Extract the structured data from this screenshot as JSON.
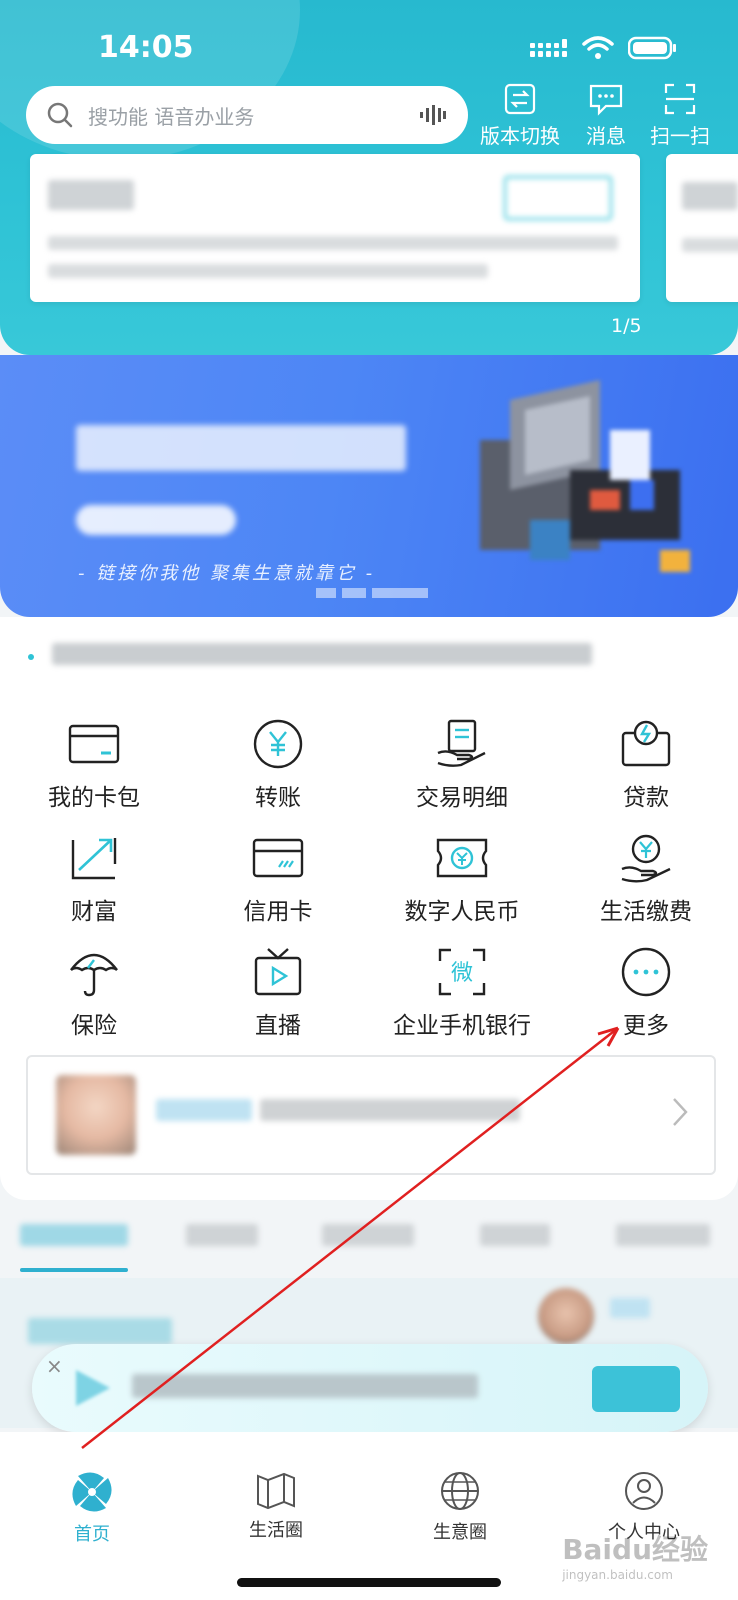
{
  "status_bar": {
    "time": "14:05"
  },
  "search": {
    "placeholder": "搜功能 语音办业务"
  },
  "top_actions": [
    {
      "label": "版本切换",
      "icon": "version-switch-icon"
    },
    {
      "label": "消息",
      "icon": "message-icon"
    },
    {
      "label": "扫一扫",
      "icon": "scan-icon"
    }
  ],
  "message_cards": {
    "pager": "1/5",
    "cards": [
      {
        "title": "",
        "button": "",
        "text": ""
      },
      {
        "title": "",
        "text": ""
      }
    ]
  },
  "banner": {
    "title": "",
    "pill": "",
    "slogan": "- 链接你我他 聚集生意就靠它 -"
  },
  "notice": {
    "text": ""
  },
  "quick_grid": [
    {
      "label": "我的卡包",
      "icon": "card-wallet-icon"
    },
    {
      "label": "转账",
      "icon": "yuan-transfer-icon"
    },
    {
      "label": "交易明细",
      "icon": "transaction-detail-icon"
    },
    {
      "label": "贷款",
      "icon": "loan-icon"
    },
    {
      "label": "财富",
      "icon": "wealth-chart-icon"
    },
    {
      "label": "信用卡",
      "icon": "credit-card-icon"
    },
    {
      "label": "数字人民币",
      "icon": "digital-rmb-icon"
    },
    {
      "label": "生活缴费",
      "icon": "life-payment-icon"
    },
    {
      "label": "保险",
      "icon": "umbrella-icon"
    },
    {
      "label": "直播",
      "icon": "live-tv-icon"
    },
    {
      "label": "企业手机银行",
      "icon": "enterprise-bank-icon"
    },
    {
      "label": "更多",
      "icon": "more-dots-icon"
    }
  ],
  "promo": {
    "tag": "",
    "text": ""
  },
  "feed_tabs": [
    {
      "label": ""
    },
    {
      "label": ""
    },
    {
      "label": ""
    },
    {
      "label": ""
    },
    {
      "label": ""
    }
  ],
  "feed": {
    "title": "",
    "name": ""
  },
  "assistant_bar": {
    "close": "×",
    "text": "",
    "button": ""
  },
  "bottom_nav": [
    {
      "label": "首页",
      "icon": "home-logo-icon",
      "active": true
    },
    {
      "label": "生活圈",
      "icon": "life-circle-icon",
      "active": false
    },
    {
      "label": "生意圈",
      "icon": "business-globe-icon",
      "active": false
    },
    {
      "label": "个人中心",
      "icon": "profile-icon",
      "active": false
    }
  ],
  "watermark": {
    "brand": "Baidu经验",
    "url": "jingyan.baidu.com"
  },
  "colors": {
    "accent": "#2fc3d6",
    "banner": "#4d86f5",
    "annotation": "#e02020"
  }
}
